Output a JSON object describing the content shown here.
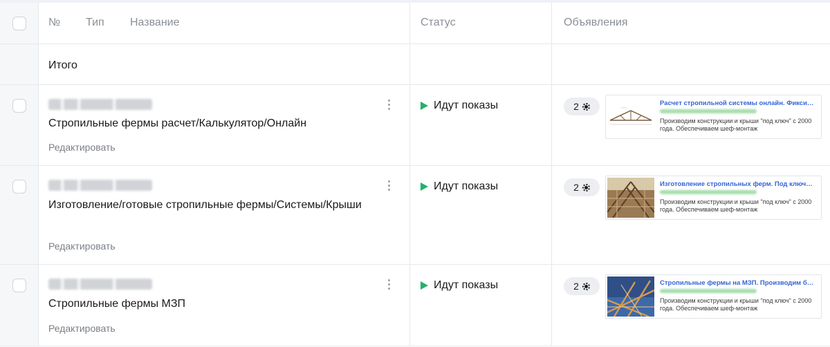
{
  "header": {
    "num": "№",
    "type": "Тип",
    "name": "Название",
    "status": "Статус",
    "ads": "Объявления"
  },
  "total_label": "Итого",
  "edit_label": "Редактировать",
  "colors": {
    "status_active": "#1fb36b",
    "ad_title": "#3565d8"
  },
  "campaigns": [
    {
      "name": "Стропильные фермы расчет/Калькулятор/Онлайн",
      "status": "Идут показы",
      "ad_count": "2",
      "ad": {
        "title": "Расчет стропильной системы онлайн. Фикси…",
        "desc": "Производим конструкции и крыши \"под ключ\" с 2000 года. Обеспечиваем шеф-монтаж",
        "thumb": "truss-diagram"
      }
    },
    {
      "name": "Изготовление/готовые стропильные фермы/Системы/Крыши",
      "status": "Идут показы",
      "ad_count": "2",
      "ad": {
        "title": "Изготовление стропильных ферм. Под ключ…",
        "desc": "Производим конструкции и крыши \"под ключ\" с 2000 года. Обеспечиваем шеф-монтаж",
        "thumb": "wooden-roof-photo"
      }
    },
    {
      "name": "Стропильные фермы МЗП",
      "status": "Идут показы",
      "ad_count": "2",
      "ad": {
        "title": "Стропильные фермы на МЗП. Производим б…",
        "desc": "Производим конструкции и крыши \"под ключ\" с 2000 года. Обеспечиваем шеф-монтаж",
        "thumb": "truss-sky-photo"
      }
    }
  ]
}
